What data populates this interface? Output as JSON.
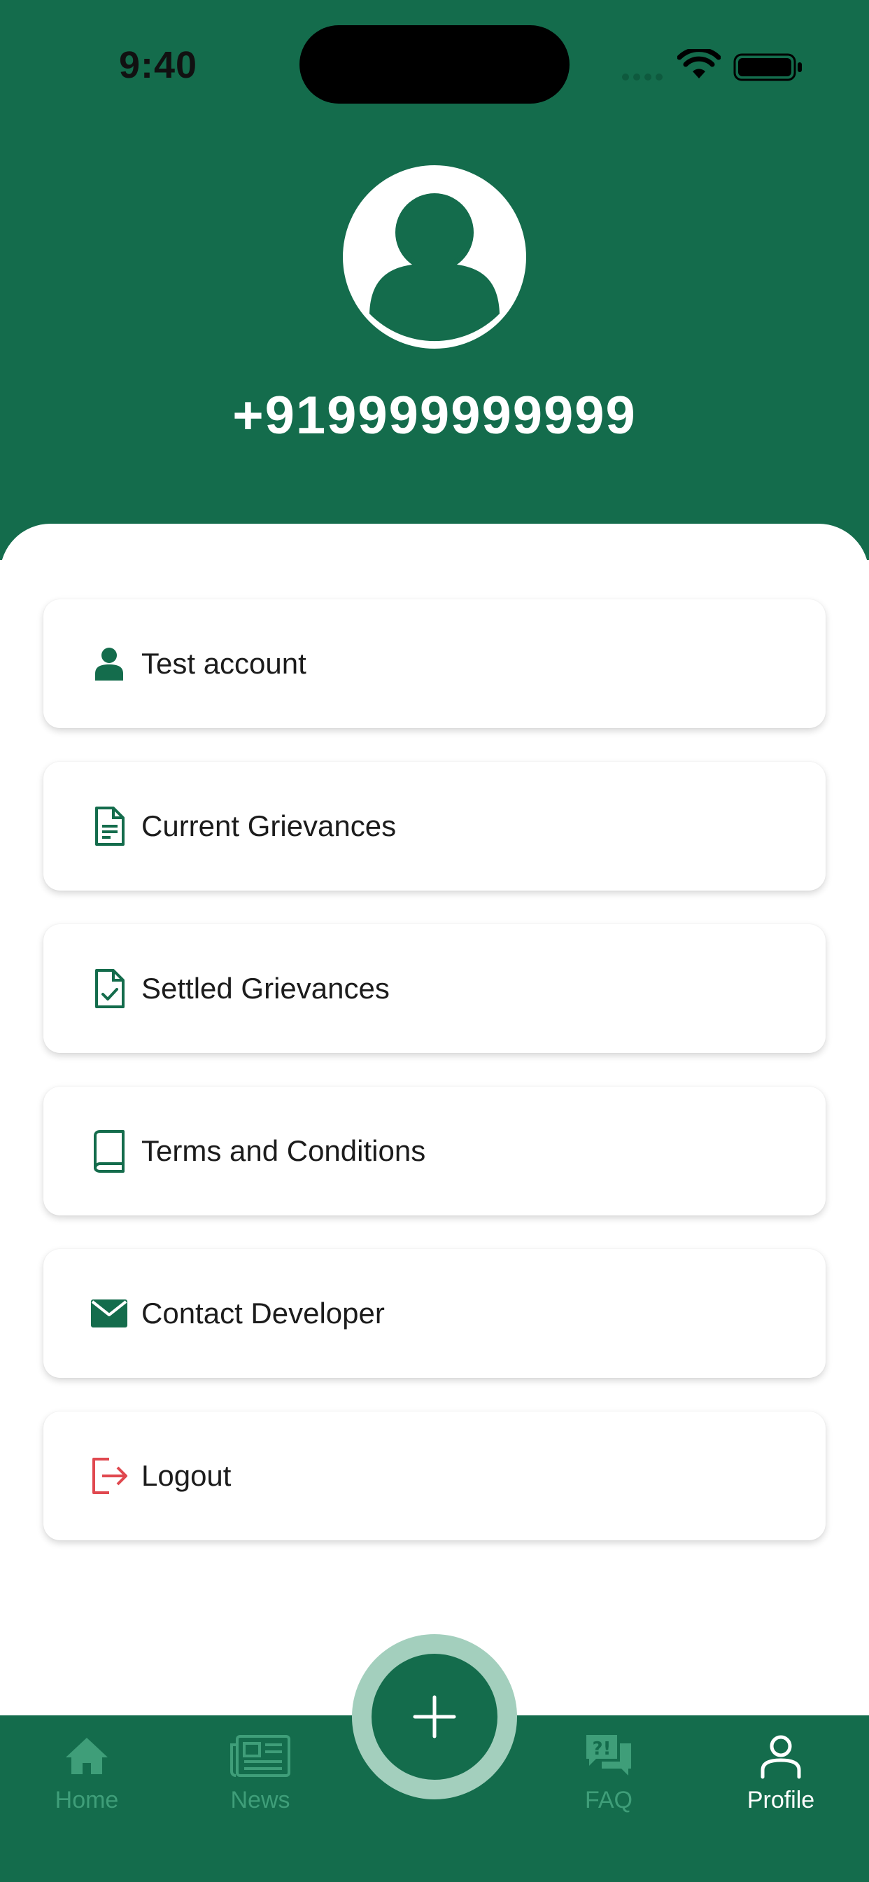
{
  "status_bar": {
    "time": "9:40"
  },
  "profile": {
    "phone": "+919999999999"
  },
  "menu": [
    {
      "label": "Test account",
      "icon": "person-icon"
    },
    {
      "label": "Current Grievances",
      "icon": "document-icon"
    },
    {
      "label": "Settled Grievances",
      "icon": "document-check-icon"
    },
    {
      "label": "Terms and Conditions",
      "icon": "book-icon"
    },
    {
      "label": "Contact Developer",
      "icon": "mail-icon"
    },
    {
      "label": "Logout",
      "icon": "logout-icon"
    }
  ],
  "tabs": [
    {
      "label": "Home",
      "icon": "home-icon"
    },
    {
      "label": "News",
      "icon": "newspaper-icon"
    },
    {
      "label": "FAQ",
      "icon": "faq-chat-icon"
    },
    {
      "label": "Profile",
      "icon": "profile-icon"
    }
  ],
  "fab": {
    "icon": "plus-icon"
  },
  "colors": {
    "primary": "#146c4c",
    "tab_inactive": "#3f9e79",
    "fab_ring": "#a3cfbd",
    "logout": "#e0484f"
  }
}
